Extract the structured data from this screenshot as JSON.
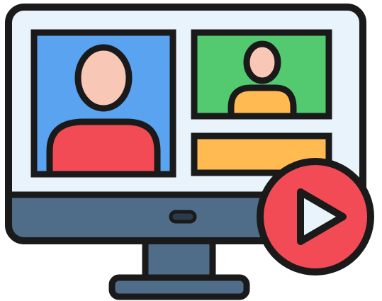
{
  "illustration": {
    "subject": "video-conference-monitor",
    "icons": [
      "monitor-icon",
      "user-avatar-icon",
      "play-icon"
    ],
    "colors": {
      "outline": "#1a1a1a",
      "screen_bg": "#e8f3fb",
      "bezel_bottom": "#4f6d88",
      "stand": "#4f6d88",
      "tile_blue": "#5aa3f0",
      "tile_green": "#53c970",
      "tile_yellow": "#ffbb52",
      "skin": "#f9c7b6",
      "shirt_red": "#f24b55",
      "shirt_yellow": "#ffbb52",
      "play_red": "#f24b55",
      "play_triangle": "#e8f3fb"
    }
  }
}
